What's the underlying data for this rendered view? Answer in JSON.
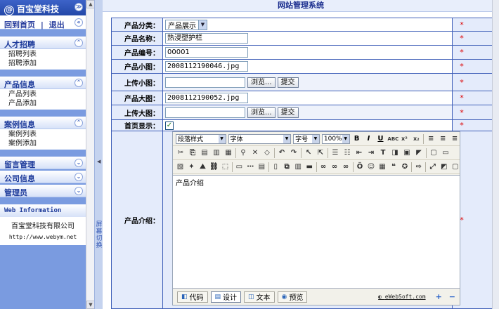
{
  "sidebar": {
    "brand": "百宝堂科技",
    "home_link": "回到首页",
    "divider": "|",
    "logout_link": "退出",
    "sections": [
      {
        "title": "人才招聘",
        "items": [
          "招聘列表",
          "招聘添加"
        ]
      },
      {
        "title": "产品信息",
        "items": [
          "产品列表",
          "产品添加"
        ]
      },
      {
        "title": "案例信息",
        "items": [
          "案例列表",
          "案例添加"
        ]
      },
      {
        "title": "留言管理",
        "items": []
      },
      {
        "title": "公司信息",
        "items": []
      },
      {
        "title": "管理员",
        "items": []
      }
    ],
    "info_title": "Web Information",
    "company": "百宝堂科技有限公司",
    "website": "http://www.webym.net"
  },
  "splitter_label": "屏幕切换",
  "header": {
    "title": "网站管理系统"
  },
  "form": {
    "category_label": "产品分类：",
    "category_value": "产品展示",
    "name_label": "产品名称：",
    "name_value": "热浸塑护栏",
    "code_label": "产品编号：",
    "code_value": "00001",
    "small_img_label": "产品小图：",
    "small_img_value": "2008112190046.jpg",
    "upload_small_label": "上传小图：",
    "large_img_label": "产品大图：",
    "large_img_value": "2008112190052.jpg",
    "upload_large_label": "上传大图：",
    "homepage_label": "首页显示：",
    "homepage_checked": true,
    "intro_label": "产品介绍：",
    "browse_btn": "浏览...",
    "submit_btn": "提交",
    "required_mark": "*"
  },
  "editor": {
    "style_select": "段落样式",
    "font_select": "字体",
    "size_select": "字号",
    "zoom_select": "100%",
    "content": "产品介绍",
    "modes": [
      "代码",
      "设计",
      "文本",
      "预览"
    ],
    "active_mode": "设计",
    "brand": "eWebSoft.com",
    "zoom_in": "+",
    "zoom_out": "−"
  }
}
